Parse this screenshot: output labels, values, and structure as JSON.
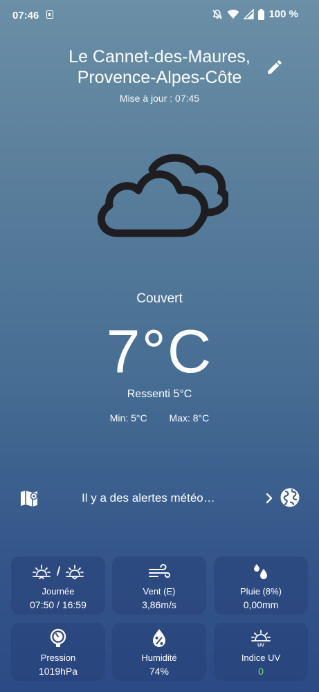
{
  "status_bar": {
    "time": "07:46",
    "battery": "100 %"
  },
  "location": {
    "line1": "Le Cannet-des-Maures,",
    "line2": "Provence-Alpes-Côte",
    "updated": "Mise à jour : 07:45"
  },
  "current": {
    "condition": "Couvert",
    "temperature": "7°C",
    "feels_like": "Ressenti 5°C",
    "min": "Min: 5°C",
    "max": "Max: 8°C",
    "icon": "cloudy-icon"
  },
  "alert": {
    "text": "Il y a des alertes météo…"
  },
  "details": [
    {
      "label": "Journée",
      "value": "07:50 / 16:59",
      "icon": "sunrise-sunset-icon"
    },
    {
      "label": "Vent (E)",
      "value": "3,86m/s",
      "icon": "wind-icon"
    },
    {
      "label": "Pluie (8%)",
      "value": "0,00mm",
      "icon": "rain-drops-icon"
    },
    {
      "label": "Pression",
      "value": "1019hPa",
      "icon": "gauge-icon"
    },
    {
      "label": "Humidité",
      "value": "74%",
      "icon": "humidity-icon"
    },
    {
      "label": "Indice UV",
      "value": "0",
      "icon": "uv-index-icon"
    }
  ],
  "colors": {
    "uv_value": "#7ee07e",
    "card_bg": "#2c4a85"
  }
}
